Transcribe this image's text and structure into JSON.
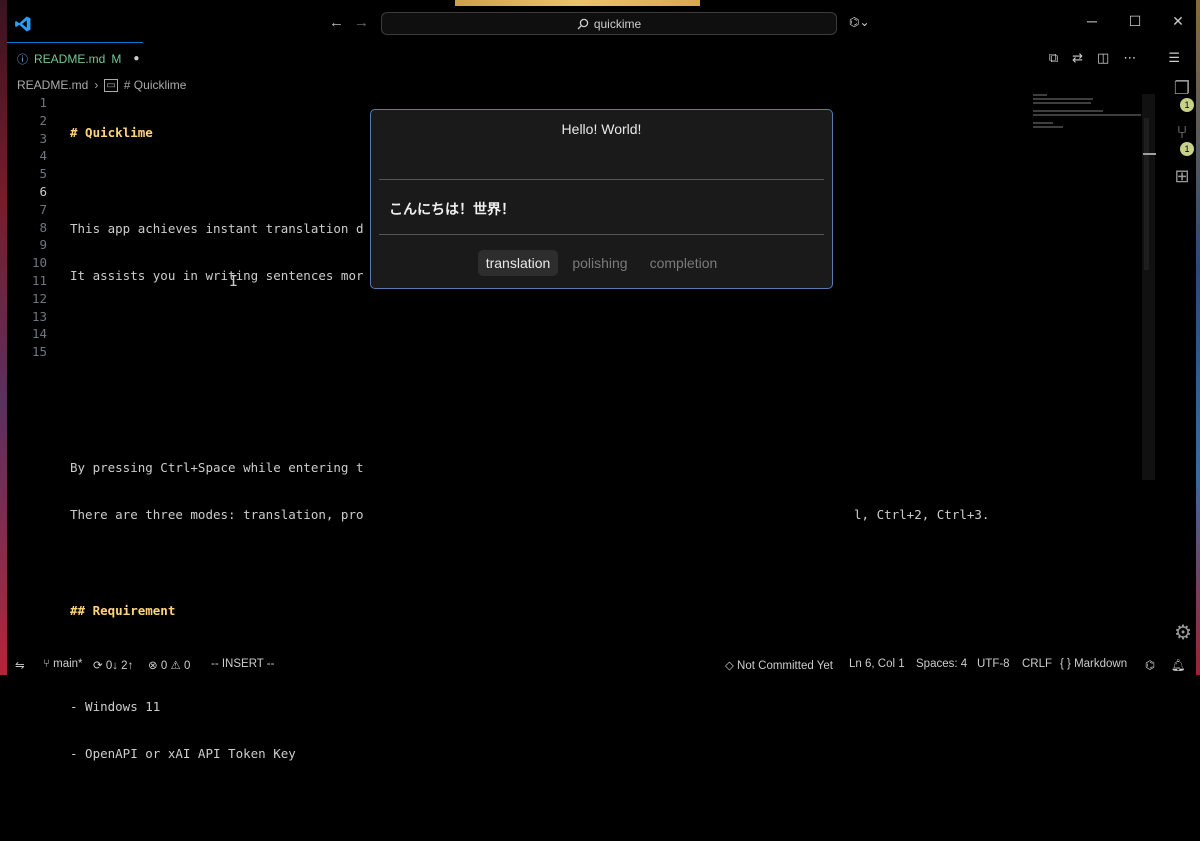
{
  "window": {
    "search_text": "quickime",
    "controls": {
      "minimize": "─",
      "maximize": "☐",
      "close": "✕"
    }
  },
  "tab": {
    "filename": "README.md",
    "modified_flag": "M"
  },
  "breadcrumb": {
    "file": "README.md",
    "separator": "›",
    "section": "# Quicklime"
  },
  "editor": {
    "line_numbers": [
      "1",
      "2",
      "3",
      "4",
      "5",
      "6",
      "7",
      "8",
      "9",
      "10",
      "11",
      "12",
      "13",
      "14",
      "15"
    ],
    "lines": [
      "# Quicklime",
      "",
      "This app achieves instant translation d",
      "It assists you in writing sentences mor",
      "",
      "",
      "",
      "By pressing Ctrl+Space while entering t",
      "There are three modes: translation, pro",
      "",
      "## Requirement",
      "",
      "- Windows 11",
      "- OpenAPI or xAI API Token Key",
      ""
    ],
    "line9_tail": "l, Ctrl+2, Ctrl+3."
  },
  "popup": {
    "source_text": "Hello! World!",
    "result_text": "こんにちは！世界！",
    "modes": [
      "translation",
      "polishing",
      "completion"
    ],
    "active_mode": "translation"
  },
  "activity": {
    "explorer_badge": "1",
    "scm_badge": "1"
  },
  "statusbar": {
    "branch": "main*",
    "sync": "0↓ 2↑",
    "errors": "0",
    "warnings": "0",
    "mode": "-- INSERT --",
    "commit_status": "Not Committed Yet",
    "position": "Ln 6, Col 1",
    "spaces": "Spaces: 4",
    "encoding": "UTF-8",
    "eol": "CRLF",
    "language": "Markdown"
  },
  "colors": {
    "accent": "#0078d4",
    "modified_green": "#73c991",
    "heading_yellow": "#ffd479",
    "popup_border": "#5a7ab0"
  },
  "icons": {
    "logo": "vscode-logo-icon",
    "search": "search-icon",
    "copilot": "copilot-icon",
    "settings": "gear-icon"
  }
}
